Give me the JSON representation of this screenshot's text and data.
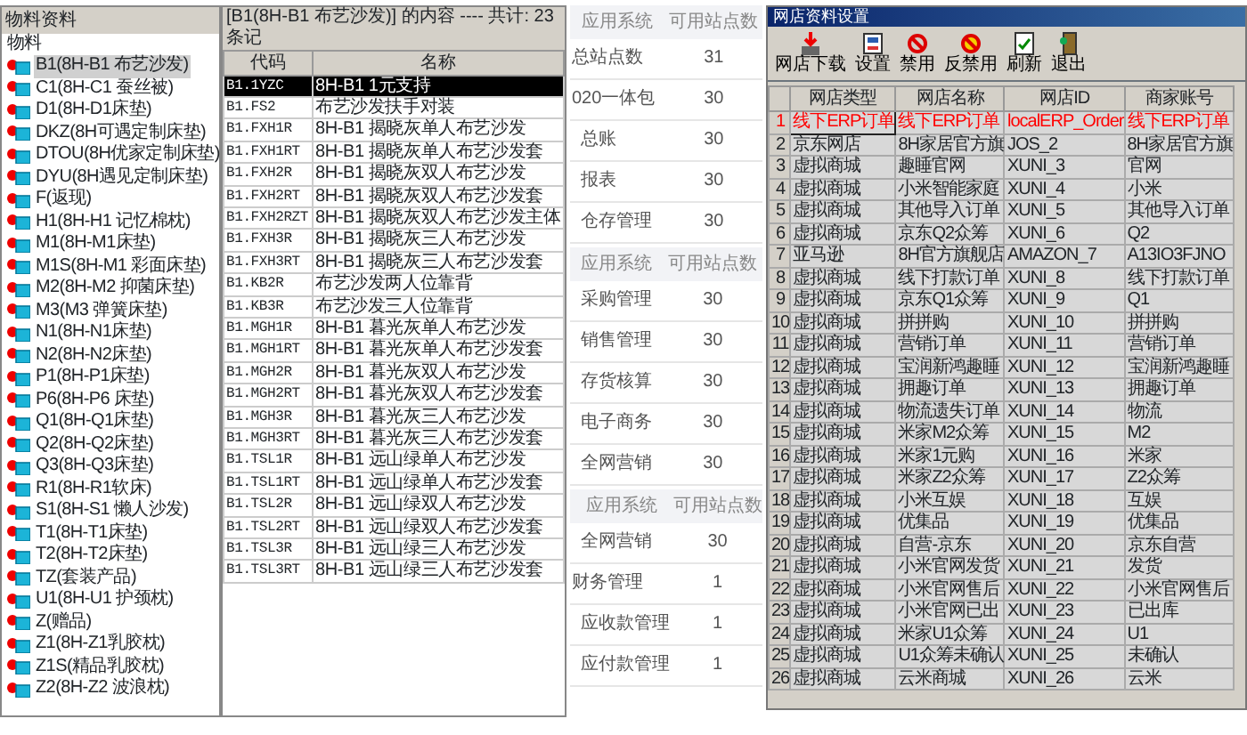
{
  "material_tree": {
    "title": "物料资料",
    "root": {
      "label": "物料",
      "children": [
        {
          "label": "B1(8H-B1 布艺沙发)",
          "selected": true
        },
        {
          "label": "C1(8H-C1 蚕丝被)",
          "selected": false
        },
        {
          "label": "D1(8H-D1床垫)",
          "selected": false
        },
        {
          "label": "DKZ(8H可遇定制床垫)",
          "selected": false
        },
        {
          "label": "DTOU(8H优家定制床垫)",
          "selected": false
        },
        {
          "label": "DYU(8H遇见定制床垫)",
          "selected": false
        },
        {
          "label": "F(返现)",
          "selected": false
        },
        {
          "label": "H1(8H-H1 记忆棉枕)",
          "selected": false
        },
        {
          "label": "M1(8H-M1床垫)",
          "selected": false
        },
        {
          "label": "M1S(8H-M1 彩面床垫)",
          "selected": false
        },
        {
          "label": "M2(8H-M2 抑菌床垫)",
          "selected": false
        },
        {
          "label": "M3(M3 弹簧床垫)",
          "selected": false
        },
        {
          "label": "N1(8H-N1床垫)",
          "selected": false
        },
        {
          "label": "N2(8H-N2床垫)",
          "selected": false
        },
        {
          "label": "P1(8H-P1床垫)",
          "selected": false
        },
        {
          "label": "P6(8H-P6 床垫)",
          "selected": false
        },
        {
          "label": "Q1(8H-Q1床垫)",
          "selected": false
        },
        {
          "label": "Q2(8H-Q2床垫)",
          "selected": false
        },
        {
          "label": "Q3(8H-Q3床垫)",
          "selected": false
        },
        {
          "label": "R1(8H-R1软床)",
          "selected": false
        },
        {
          "label": "S1(8H-S1 懒人沙发)",
          "selected": false
        },
        {
          "label": "T1(8H-T1床垫)",
          "selected": false
        },
        {
          "label": "T2(8H-T2床垫)",
          "selected": false
        },
        {
          "label": "TZ(套装产品)",
          "selected": false
        },
        {
          "label": "U1(8H-U1 护颈枕)",
          "selected": false
        },
        {
          "label": "Z(赠品)",
          "selected": false
        },
        {
          "label": "Z1(8H-Z1乳胶枕)",
          "selected": false
        },
        {
          "label": "Z1S(精品乳胶枕)",
          "selected": false
        },
        {
          "label": "Z2(8H-Z2 波浪枕)",
          "selected": false
        }
      ]
    }
  },
  "material_table": {
    "caption": "[B1(8H-B1 布艺沙发)] 的内容 ---- 共计: 23 条记",
    "columns": [
      "代码",
      "名称"
    ],
    "rows": [
      {
        "code": "B1.1YZC",
        "name": "8H-B1 1元支持",
        "selected": true
      },
      {
        "code": "B1.FS2",
        "name": "布艺沙发扶手对装",
        "selected": false
      },
      {
        "code": "B1.FXH1R",
        "name": "8H-B1 揭晓灰单人布艺沙发",
        "selected": false
      },
      {
        "code": "B1.FXH1RT",
        "name": "8H-B1 揭晓灰单人布艺沙发套",
        "selected": false
      },
      {
        "code": "B1.FXH2R",
        "name": "8H-B1 揭晓灰双人布艺沙发",
        "selected": false
      },
      {
        "code": "B1.FXH2RT",
        "name": "8H-B1 揭晓灰双人布艺沙发套",
        "selected": false
      },
      {
        "code": "B1.FXH2RZT",
        "name": "8H-B1 揭晓灰双人布艺沙发主体",
        "selected": false
      },
      {
        "code": "B1.FXH3R",
        "name": "8H-B1 揭晓灰三人布艺沙发",
        "selected": false
      },
      {
        "code": "B1.FXH3RT",
        "name": "8H-B1 揭晓灰三人布艺沙发套",
        "selected": false
      },
      {
        "code": "B1.KB2R",
        "name": "布艺沙发两人位靠背",
        "selected": false
      },
      {
        "code": "B1.KB3R",
        "name": "布艺沙发三人位靠背",
        "selected": false
      },
      {
        "code": "B1.MGH1R",
        "name": "8H-B1 暮光灰单人布艺沙发",
        "selected": false
      },
      {
        "code": "B1.MGH1RT",
        "name": "8H-B1 暮光灰单人布艺沙发套",
        "selected": false
      },
      {
        "code": "B1.MGH2R",
        "name": "8H-B1 暮光灰双人布艺沙发",
        "selected": false
      },
      {
        "code": "B1.MGH2RT",
        "name": "8H-B1 暮光灰双人布艺沙发套",
        "selected": false
      },
      {
        "code": "B1.MGH3R",
        "name": "8H-B1 暮光灰三人布艺沙发",
        "selected": false
      },
      {
        "code": "B1.MGH3RT",
        "name": "8H-B1 暮光灰三人布艺沙发套",
        "selected": false
      },
      {
        "code": "B1.TSL1R",
        "name": "8H-B1 远山绿单人布艺沙发",
        "selected": false
      },
      {
        "code": "B1.TSL1RT",
        "name": "8H-B1 远山绿单人布艺沙发套",
        "selected": false
      },
      {
        "code": "B1.TSL2R",
        "name": "8H-B1 远山绿双人布艺沙发",
        "selected": false
      },
      {
        "code": "B1.TSL2RT",
        "name": "8H-B1 远山绿双人布艺沙发套",
        "selected": false
      },
      {
        "code": "B1.TSL3R",
        "name": "8H-B1 远山绿三人布艺沙发",
        "selected": false
      },
      {
        "code": "B1.TSL3RT",
        "name": "8H-B1 远山绿三人布艺沙发套",
        "selected": false
      }
    ]
  },
  "site_tables": [
    {
      "columns": [
        "应用系统",
        "可用站点数"
      ],
      "rows": [
        {
          "label": "总站点数",
          "count": "31",
          "kind": "main"
        },
        {
          "label": "020一体包",
          "count": "30",
          "kind": "main",
          "children": [
            {
              "label": "总账",
              "count": "30"
            },
            {
              "label": "报表",
              "count": "30"
            },
            {
              "label": "仓存管理",
              "count": "30"
            }
          ]
        }
      ]
    },
    {
      "columns": [
        "应用系统",
        "可用站点数"
      ],
      "rows": [
        {
          "label": "采购管理",
          "count": "30",
          "kind": "sub"
        },
        {
          "label": "销售管理",
          "count": "30",
          "kind": "sub"
        },
        {
          "label": "存货核算",
          "count": "30",
          "kind": "sub"
        },
        {
          "label": "电子商务",
          "count": "30",
          "kind": "sub"
        },
        {
          "label": "全网营销",
          "count": "30",
          "kind": "sub"
        }
      ]
    },
    {
      "columns": [
        "应用系统",
        "可用站点数"
      ],
      "rows": [
        {
          "label": "全网营销",
          "count": "30",
          "kind": "sub"
        },
        {
          "label": "财务管理",
          "count": "1",
          "kind": "main",
          "children": [
            {
              "label": "应收款管理",
              "count": "1"
            },
            {
              "label": "应付款管理",
              "count": "1"
            }
          ]
        }
      ]
    }
  ],
  "shop_window": {
    "title": "网店资料设置",
    "toolbar": [
      {
        "label": "网店下载",
        "kind": "download"
      },
      {
        "label": "设置",
        "kind": "settings"
      },
      {
        "label": "禁用",
        "kind": "ban"
      },
      {
        "label": "反禁用",
        "kind": "unban"
      },
      {
        "label": "刷新",
        "kind": "refresh"
      },
      {
        "label": "退出",
        "kind": "exit"
      }
    ],
    "columns": [
      "网店类型",
      "网店名称",
      "网店ID",
      "商家账号"
    ],
    "rows": [
      {
        "no": "1",
        "type": "线下ERP订单",
        "name": "线下ERP订单",
        "id": "localERP_Order",
        "account": "线下ERP订单",
        "flagged": true
      },
      {
        "no": "2",
        "type": "京东网店",
        "name": "8H家居官方旗",
        "id": "JOS_2",
        "account": "8H家居官方旗",
        "flagged": false
      },
      {
        "no": "3",
        "type": "虚拟商城",
        "name": "趣睡官网",
        "id": "XUNI_3",
        "account": "官网",
        "flagged": false
      },
      {
        "no": "4",
        "type": "虚拟商城",
        "name": "小米智能家庭",
        "id": "XUNI_4",
        "account": "小米",
        "flagged": false
      },
      {
        "no": "5",
        "type": "虚拟商城",
        "name": "其他导入订单",
        "id": "XUNI_5",
        "account": "其他导入订单",
        "flagged": false
      },
      {
        "no": "6",
        "type": "虚拟商城",
        "name": "京东Q2众筹",
        "id": "XUNI_6",
        "account": "Q2",
        "flagged": false
      },
      {
        "no": "7",
        "type": "亚马逊",
        "name": "8H官方旗舰店",
        "id": "AMAZON_7",
        "account": "A13IO3FJNO",
        "flagged": false
      },
      {
        "no": "8",
        "type": "虚拟商城",
        "name": "线下打款订单",
        "id": "XUNI_8",
        "account": "线下打款订单",
        "flagged": false
      },
      {
        "no": "9",
        "type": "虚拟商城",
        "name": "京东Q1众筹",
        "id": "XUNI_9",
        "account": "Q1",
        "flagged": false
      },
      {
        "no": "10",
        "type": "虚拟商城",
        "name": "拼拼购",
        "id": "XUNI_10",
        "account": "拼拼购",
        "flagged": false
      },
      {
        "no": "11",
        "type": "虚拟商城",
        "name": "营销订单",
        "id": "XUNI_11",
        "account": "营销订单",
        "flagged": false
      },
      {
        "no": "12",
        "type": "虚拟商城",
        "name": "宝润新鸿趣睡",
        "id": "XUNI_12",
        "account": "宝润新鸿趣睡",
        "flagged": false
      },
      {
        "no": "13",
        "type": "虚拟商城",
        "name": "拥趣订单",
        "id": "XUNI_13",
        "account": "拥趣订单",
        "flagged": false
      },
      {
        "no": "14",
        "type": "虚拟商城",
        "name": "物流遗失订单",
        "id": "XUNI_14",
        "account": "物流",
        "flagged": false
      },
      {
        "no": "15",
        "type": "虚拟商城",
        "name": "米家M2众筹",
        "id": "XUNI_15",
        "account": "M2",
        "flagged": false
      },
      {
        "no": "16",
        "type": "虚拟商城",
        "name": "米家1元购",
        "id": "XUNI_16",
        "account": "米家",
        "flagged": false
      },
      {
        "no": "17",
        "type": "虚拟商城",
        "name": "米家Z2众筹",
        "id": "XUNI_17",
        "account": "Z2众筹",
        "flagged": false
      },
      {
        "no": "18",
        "type": "虚拟商城",
        "name": "小米互娱",
        "id": "XUNI_18",
        "account": "互娱",
        "flagged": false
      },
      {
        "no": "19",
        "type": "虚拟商城",
        "name": "优集品",
        "id": "XUNI_19",
        "account": "优集品",
        "flagged": false
      },
      {
        "no": "20",
        "type": "虚拟商城",
        "name": "自营-京东",
        "id": "XUNI_20",
        "account": "京东自营",
        "flagged": false
      },
      {
        "no": "21",
        "type": "虚拟商城",
        "name": "小米官网发货",
        "id": "XUNI_21",
        "account": "发货",
        "flagged": false
      },
      {
        "no": "22",
        "type": "虚拟商城",
        "name": "小米官网售后",
        "id": "XUNI_22",
        "account": "小米官网售后",
        "flagged": false
      },
      {
        "no": "23",
        "type": "虚拟商城",
        "name": "小米官网已出",
        "id": "XUNI_23",
        "account": "已出库",
        "flagged": false
      },
      {
        "no": "24",
        "type": "虚拟商城",
        "name": "米家U1众筹",
        "id": "XUNI_24",
        "account": "U1",
        "flagged": false
      },
      {
        "no": "25",
        "type": "虚拟商城",
        "name": "U1众筹未确认",
        "id": "XUNI_25",
        "account": "未确认",
        "flagged": false
      },
      {
        "no": "26",
        "type": "虚拟商城",
        "name": "云米商城",
        "id": "XUNI_26",
        "account": "云米",
        "flagged": false
      }
    ]
  }
}
